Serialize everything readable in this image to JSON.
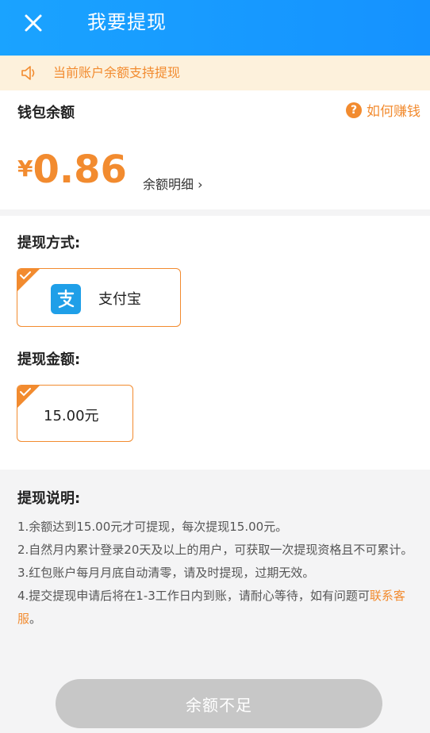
{
  "header": {
    "title": "我要提现"
  },
  "notice": {
    "text": "当前账户余额支持提现"
  },
  "wallet": {
    "label": "钱包余额",
    "earn_link": "如何赚钱",
    "currency": "¥",
    "amount": "0.86",
    "detail_link": "余额明细",
    "detail_chevron": "›"
  },
  "withdraw_method": {
    "title": "提现方式:",
    "selected": "支付宝"
  },
  "withdraw_amount": {
    "title": "提现金额:",
    "selected": "15.00元"
  },
  "explanation": {
    "title": "提现说明:",
    "line1": "1.余额达到15.00元才可提现，每次提现15.00元。",
    "line2": "2.自然月内累计登录20天及以上的用户，可获取一次提现资格且不可累计。",
    "line3": "3.红包账户每月月底自动清零，请及时提现，过期无效。",
    "line4_prefix": "4.提交提现申请后将在1-3工作日内到账，请耐心等待，如有问题可",
    "line4_link": "联系客服",
    "line4_suffix": "。"
  },
  "submit": {
    "label": "余额不足"
  },
  "colors": {
    "accent": "#f28b2f",
    "header": "#1592ff",
    "disabled": "#c7c7c7"
  }
}
